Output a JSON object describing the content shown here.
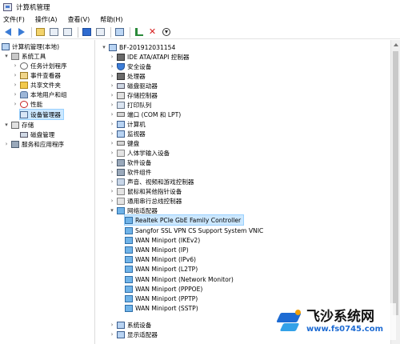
{
  "window": {
    "title": "计算机管理",
    "icon": "computer-management-icon"
  },
  "menu": [
    {
      "label": "文件(F)"
    },
    {
      "label": "操作(A)"
    },
    {
      "label": "查看(V)"
    },
    {
      "label": "帮助(H)"
    }
  ],
  "toolbar": {
    "icons": [
      "back-icon",
      "forward-icon",
      "up-folder-icon",
      "show-hide-tree-icon",
      "properties-icon",
      "help-icon",
      "monitor-icon",
      "update-driver-icon",
      "uninstall-icon",
      "download-icon"
    ]
  },
  "left_tree": [
    {
      "label": "计算机管理(本地)",
      "icon": "computer-icon",
      "indent": 0,
      "expander": ""
    },
    {
      "label": "系统工具",
      "icon": "tools-icon",
      "indent": 1,
      "expander": "▾"
    },
    {
      "label": "任务计划程序",
      "icon": "clock-icon",
      "indent": 2,
      "expander": "›"
    },
    {
      "label": "事件查看器",
      "icon": "event-viewer-icon",
      "indent": 2,
      "expander": "›"
    },
    {
      "label": "共享文件夹",
      "icon": "folder-icon",
      "indent": 2,
      "expander": "›"
    },
    {
      "label": "本地用户和组",
      "icon": "users-icon",
      "indent": 2,
      "expander": "›"
    },
    {
      "label": "性能",
      "icon": "performance-icon",
      "indent": 2,
      "expander": "›"
    },
    {
      "label": "设备管理器",
      "icon": "device-manager-icon",
      "indent": 2,
      "expander": "",
      "selected": true
    },
    {
      "label": "存储",
      "icon": "storage-icon",
      "indent": 1,
      "expander": "▾"
    },
    {
      "label": "磁盘管理",
      "icon": "disk-icon",
      "indent": 2,
      "expander": ""
    },
    {
      "label": "服务和应用程序",
      "icon": "services-icon",
      "indent": 1,
      "expander": "›"
    }
  ],
  "device_tree": {
    "root": {
      "label": "BF-201912031154",
      "icon": "computer-icon",
      "expander": "▾"
    },
    "items": [
      {
        "label": "IDE ATA/ATAPI 控制器",
        "icon": "ide-controller-icon",
        "indent": 1,
        "expander": "›"
      },
      {
        "label": "安全设备",
        "icon": "security-device-icon",
        "indent": 1,
        "expander": "›"
      },
      {
        "label": "处理器",
        "icon": "processor-icon",
        "indent": 1,
        "expander": "›"
      },
      {
        "label": "磁盘驱动器",
        "icon": "disk-drive-icon",
        "indent": 1,
        "expander": "›"
      },
      {
        "label": "存储控制器",
        "icon": "storage-controller-icon",
        "indent": 1,
        "expander": "›"
      },
      {
        "label": "打印队列",
        "icon": "printer-icon",
        "indent": 1,
        "expander": "›"
      },
      {
        "label": "端口 (COM 和 LPT)",
        "icon": "port-icon",
        "indent": 1,
        "expander": "›"
      },
      {
        "label": "计算机",
        "icon": "computer-icon",
        "indent": 1,
        "expander": "›"
      },
      {
        "label": "监视器",
        "icon": "monitor-icon",
        "indent": 1,
        "expander": "›"
      },
      {
        "label": "键盘",
        "icon": "keyboard-icon",
        "indent": 1,
        "expander": "›"
      },
      {
        "label": "人体学输入设备",
        "icon": "hid-icon",
        "indent": 1,
        "expander": "›"
      },
      {
        "label": "软件设备",
        "icon": "software-device-icon",
        "indent": 1,
        "expander": "›"
      },
      {
        "label": "软件组件",
        "icon": "software-component-icon",
        "indent": 1,
        "expander": "›"
      },
      {
        "label": "声音、视频和游戏控制器",
        "icon": "audio-icon",
        "indent": 1,
        "expander": "›"
      },
      {
        "label": "鼠标和其他指针设备",
        "icon": "mouse-icon",
        "indent": 1,
        "expander": "›"
      },
      {
        "label": "通用串行总线控制器",
        "icon": "usb-icon",
        "indent": 1,
        "expander": "›"
      },
      {
        "label": "网络适配器",
        "icon": "network-adapter-icon",
        "indent": 1,
        "expander": "▾"
      },
      {
        "label": "Realtek PCIe GbE Family Controller",
        "icon": "network-adapter-icon",
        "indent": 2,
        "expander": "",
        "selected": true
      },
      {
        "label": "Sangfor SSL VPN CS Support System VNIC",
        "icon": "network-adapter-icon",
        "indent": 2,
        "expander": ""
      },
      {
        "label": "WAN Miniport (IKEv2)",
        "icon": "network-adapter-icon",
        "indent": 2,
        "expander": ""
      },
      {
        "label": "WAN Miniport (IP)",
        "icon": "network-adapter-icon",
        "indent": 2,
        "expander": ""
      },
      {
        "label": "WAN Miniport (IPv6)",
        "icon": "network-adapter-icon",
        "indent": 2,
        "expander": ""
      },
      {
        "label": "WAN Miniport (L2TP)",
        "icon": "network-adapter-icon",
        "indent": 2,
        "expander": ""
      },
      {
        "label": "WAN Miniport (Network Monitor)",
        "icon": "network-adapter-icon",
        "indent": 2,
        "expander": ""
      },
      {
        "label": "WAN Miniport (PPPOE)",
        "icon": "network-adapter-icon",
        "indent": 2,
        "expander": ""
      },
      {
        "label": "WAN Miniport (PPTP)",
        "icon": "network-adapter-icon",
        "indent": 2,
        "expander": ""
      },
      {
        "label": "WAN Miniport (SSTP)",
        "icon": "network-adapter-icon",
        "indent": 2,
        "expander": ""
      },
      {
        "label": "系统设备",
        "icon": "system-device-icon",
        "indent": 1,
        "expander": "›"
      },
      {
        "label": "显示适配器",
        "icon": "display-adapter-icon",
        "indent": 1,
        "expander": "›"
      }
    ]
  },
  "watermark": {
    "name": "飞沙系统网",
    "url": "www.fs0745.com"
  },
  "colors": {
    "selection": "#cce8ff",
    "accent": "#3a7bd5"
  }
}
